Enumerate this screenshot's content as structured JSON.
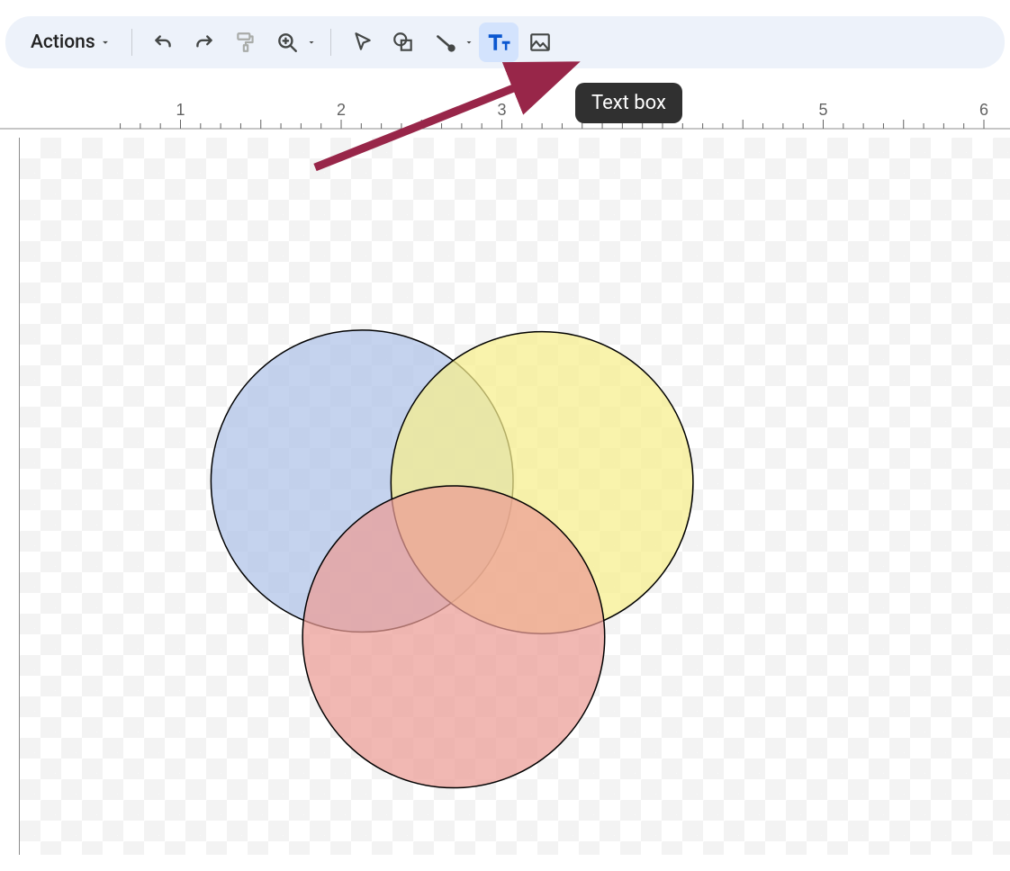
{
  "toolbar": {
    "actions_label": "Actions",
    "buttons": {
      "undo": "Undo",
      "redo": "Redo",
      "paint_format": "Paint format",
      "zoom": "Zoom",
      "select": "Select",
      "shape": "Shape",
      "line": "Line",
      "textbox": "Text box",
      "image": "Image"
    },
    "active": "textbox",
    "tooltip": "Text box"
  },
  "ruler": {
    "unit": "inches",
    "visible_min": 0.6,
    "visible_max": 6.1,
    "major_ticks": [
      1,
      2,
      3,
      4,
      5,
      6
    ]
  },
  "canvas": {
    "shapes": [
      {
        "name": "circle-blue",
        "cx_in": 2.13,
        "cy_in": 2.25,
        "r_in": 0.94,
        "fill": "#aec2e8",
        "opacity": 0.72
      },
      {
        "name": "circle-yellow",
        "cx_in": 3.25,
        "cy_in": 2.26,
        "r_in": 0.94,
        "fill": "#f7ee8c",
        "opacity": 0.72
      },
      {
        "name": "circle-red",
        "cx_in": 2.7,
        "cy_in": 3.22,
        "r_in": 0.94,
        "fill": "#ec9c95",
        "opacity": 0.72
      }
    ]
  },
  "annotation": {
    "arrow_color": "#982649"
  }
}
